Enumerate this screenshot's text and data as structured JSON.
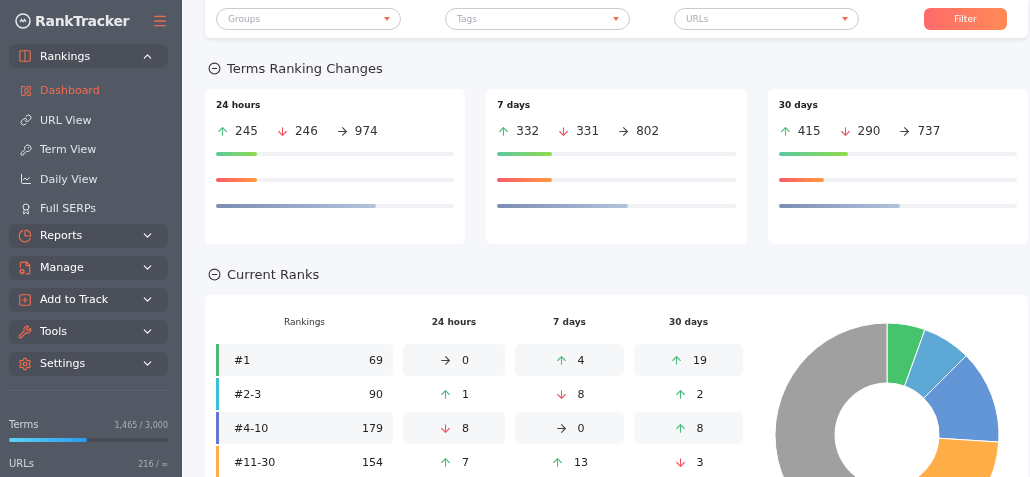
{
  "sidebar": {
    "logo": "RankTracker",
    "nav": [
      {
        "label": "Rankings",
        "expanded": true,
        "children": [
          {
            "label": "Dashboard",
            "selected": true
          },
          {
            "label": "URL View",
            "selected": false
          },
          {
            "label": "Term View",
            "selected": false
          },
          {
            "label": "Daily View",
            "selected": false
          },
          {
            "label": "Full SERPs",
            "selected": false
          }
        ]
      },
      {
        "label": "Reports",
        "expanded": false
      },
      {
        "label": "Manage",
        "expanded": false
      },
      {
        "label": "Add to Track",
        "expanded": false
      },
      {
        "label": "Tools",
        "expanded": false
      },
      {
        "label": "Settings",
        "expanded": false
      }
    ],
    "usage": [
      {
        "label": "Terms",
        "reading": "1,465 / 3,000",
        "level": 0.49
      },
      {
        "label": "URLs",
        "reading": "216 / ∞"
      }
    ]
  },
  "filters": {
    "selects": [
      {
        "placeholder": "Groups"
      },
      {
        "placeholder": "Tags"
      },
      {
        "placeholder": "URLs"
      }
    ],
    "button": "Filter"
  },
  "changes": {
    "title": "Terms Ranking Changes",
    "cards": [
      {
        "period": "24 hours",
        "up": "245",
        "down": "246",
        "flat": "974",
        "bars": [
          {
            "kind": "up",
            "level": 0.17
          },
          {
            "kind": "down",
            "level": 0.17
          },
          {
            "kind": "flat",
            "level": 0.67
          }
        ]
      },
      {
        "period": "7 days",
        "up": "332",
        "down": "331",
        "flat": "802",
        "bars": [
          {
            "kind": "up",
            "level": 0.23
          },
          {
            "kind": "down",
            "level": 0.23
          },
          {
            "kind": "flat",
            "level": 0.55
          }
        ]
      },
      {
        "period": "30 days",
        "up": "415",
        "down": "290",
        "flat": "737",
        "bars": [
          {
            "kind": "up",
            "level": 0.29
          },
          {
            "kind": "down",
            "level": 0.19
          },
          {
            "kind": "flat",
            "level": 0.51
          }
        ]
      }
    ]
  },
  "ranks": {
    "title": "Current Ranks",
    "columns": [
      "Rankings",
      "24 hours",
      "7 days",
      "30 days"
    ],
    "rows": [
      {
        "label": "#1",
        "count": "69",
        "color": "#4cba7a",
        "changes": [
          {
            "kind": "flat",
            "value": "0"
          },
          {
            "kind": "up",
            "value": "4"
          },
          {
            "kind": "up",
            "value": "19"
          }
        ]
      },
      {
        "label": "#2-3",
        "count": "90",
        "color": "#3bbfd6",
        "changes": [
          {
            "kind": "up",
            "value": "1"
          },
          {
            "kind": "down",
            "value": "8"
          },
          {
            "kind": "up",
            "value": "2"
          }
        ]
      },
      {
        "label": "#4-10",
        "count": "179",
        "color": "#6a76d6",
        "changes": [
          {
            "kind": "down",
            "value": "8"
          },
          {
            "kind": "flat",
            "value": "0"
          },
          {
            "kind": "up",
            "value": "8"
          }
        ]
      },
      {
        "label": "#11-30",
        "count": "154",
        "color": "#ffad47",
        "changes": [
          {
            "kind": "up",
            "value": "7"
          },
          {
            "kind": "up",
            "value": "13"
          },
          {
            "kind": "down",
            "value": "3"
          }
        ]
      }
    ]
  }
}
